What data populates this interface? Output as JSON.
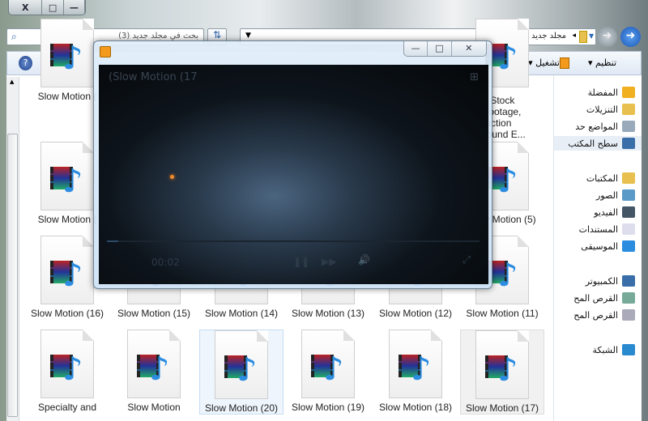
{
  "window": {
    "close": "X",
    "maximize": "□",
    "minimize": "—"
  },
  "address": {
    "path": "مجلد جديد (3)",
    "separator": "◂",
    "search_placeholder": "بحث في مجلد جديد (3)"
  },
  "toolbar": {
    "organize": "تنظيم ▾",
    "play": "تشغيل ▾",
    "view_dropdown": "▾"
  },
  "files": [
    {
      "label": "Slow Motion (",
      "col": 0,
      "row": 0
    },
    {
      "label": "ble Stock\no Footage,\noduction\n, Sound E...",
      "col": 5,
      "row": 0
    },
    {
      "label": "Slow Motion (",
      "col": 0,
      "row": 1
    },
    {
      "label": "Slow Motion (5)",
      "col": 5,
      "row": 1
    },
    {
      "label": "Slow Motion (16)",
      "col": 0,
      "row": 2
    },
    {
      "label": "Slow Motion (15)",
      "col": 1,
      "row": 2
    },
    {
      "label": "Slow Motion (14)",
      "col": 2,
      "row": 2
    },
    {
      "label": "Slow Motion (13)",
      "col": 3,
      "row": 2
    },
    {
      "label": "Slow Motion (12)",
      "col": 4,
      "row": 2
    },
    {
      "label": "Slow Motion (11)",
      "col": 5,
      "row": 2
    },
    {
      "label": "Specialty and",
      "col": 0,
      "row": 3
    },
    {
      "label": "Slow Motion",
      "col": 1,
      "row": 3
    },
    {
      "label": "Slow Motion (20)",
      "col": 2,
      "row": 3,
      "state": "selected"
    },
    {
      "label": "Slow Motion (19)",
      "col": 3,
      "row": 3
    },
    {
      "label": "Slow Motion (18)",
      "col": 4,
      "row": 3
    },
    {
      "label": "Slow Motion (17)",
      "col": 5,
      "row": 3,
      "state": "hover"
    }
  ],
  "nav": [
    {
      "label": "المفضلة",
      "icon": "star-icon",
      "color": "#f0b020",
      "group": true
    },
    {
      "label": "التنزيلات",
      "icon": "downloads-folder-icon",
      "color": "#e8c050"
    },
    {
      "label": "المواضع حد",
      "icon": "recent-places-icon",
      "color": "#9ab"
    },
    {
      "label": "سطح المكتب",
      "icon": "desktop-icon",
      "color": "#3a6ea8",
      "selected": true
    },
    {
      "label": "المكتبات",
      "icon": "libraries-icon",
      "color": "#e8c050",
      "group": true
    },
    {
      "label": "الصور",
      "icon": "pictures-icon",
      "color": "#5a9ac8"
    },
    {
      "label": "الفيديو",
      "icon": "video-icon",
      "color": "#456"
    },
    {
      "label": "المستندات",
      "icon": "documents-icon",
      "color": "#dde"
    },
    {
      "label": "الموسيقى",
      "icon": "music-icon",
      "color": "#2b8ce0"
    },
    {
      "label": "الكمبيوتر",
      "icon": "computer-icon",
      "color": "#3a6ea8",
      "group": true
    },
    {
      "label": "القرص المح",
      "icon": "system-drive-icon",
      "color": "#7a9"
    },
    {
      "label": "القرص المح",
      "icon": "drive-icon",
      "color": "#aab"
    },
    {
      "label": "الشبكة",
      "icon": "network-icon",
      "color": "#2a8ad0",
      "group": true
    }
  ],
  "player": {
    "title": "(Slow Motion (17",
    "time": "00:02",
    "progress_percent": 3,
    "controls": {
      "pause": "❚❚",
      "next": "▶▶",
      "volume": "🔊",
      "fullscreen": "⤢",
      "switch_to_library": "⊞"
    }
  },
  "colors": {
    "accent": "#2b8ce0",
    "selection": "#eef5fc"
  }
}
